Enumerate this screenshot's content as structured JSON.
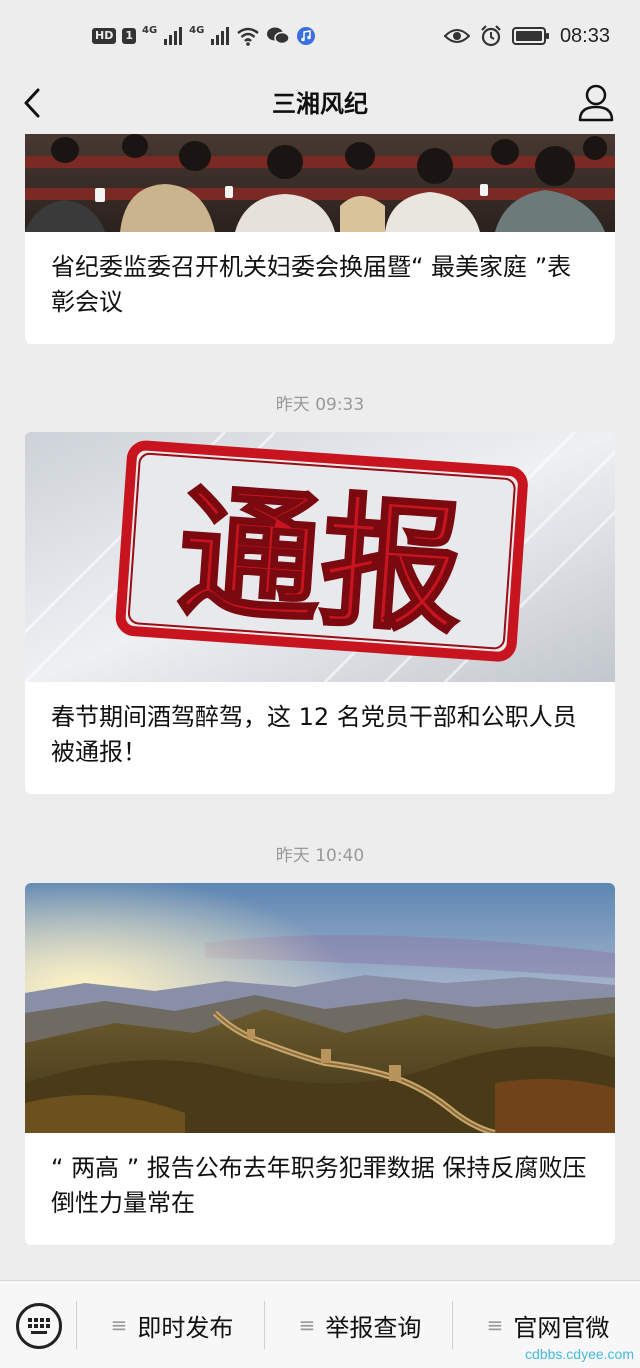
{
  "status_bar": {
    "badges": [
      "HD",
      "1"
    ],
    "net1": "4G",
    "net2": "4G",
    "time": "08:33"
  },
  "header": {
    "title": "三湘风纪"
  },
  "feed": {
    "articles": [
      {
        "title": "省纪委监委召开机关妇委会换届暨“ 最美家庭 ”表彰会议",
        "image": "meeting-photo"
      },
      {
        "time": "昨天 09:33",
        "title": "春节期间酒驾醉驾，这 12 名党员干部和公职人员被通报！",
        "image": "tongbao-banner",
        "banner_text": "通报"
      },
      {
        "time": "昨天 10:40",
        "title": "“ 两高 ” 报告公布去年职务犯罪数据 保持反腐败压倒性力量常在",
        "image": "great-wall-photo"
      }
    ]
  },
  "bottom_menu": {
    "items": [
      {
        "label": "即时发布"
      },
      {
        "label": "举报查询"
      },
      {
        "label": "官网官微"
      }
    ]
  },
  "watermark": {
    "text": "cdbbs.cdyee.com"
  },
  "colors": {
    "background": "#ededed",
    "card": "#ffffff",
    "time_gray": "#999999",
    "banner_red": "#c8141e"
  }
}
